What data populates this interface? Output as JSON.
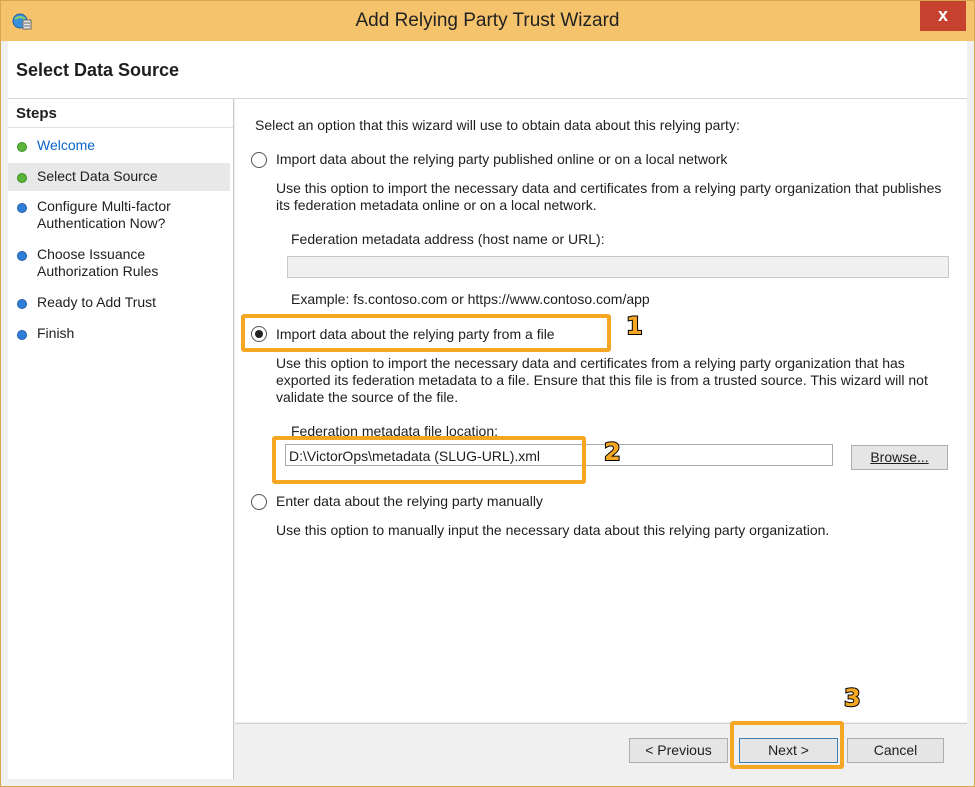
{
  "window": {
    "title": "Add Relying Party Trust Wizard",
    "close_label": "x"
  },
  "header": {
    "title": "Select Data Source"
  },
  "steps": {
    "title": "Steps",
    "items": [
      {
        "label": "Welcome",
        "state": "done-link"
      },
      {
        "label": "Select Data Source",
        "state": "current"
      },
      {
        "label": "Configure Multi-factor Authentication Now?",
        "state": "pending"
      },
      {
        "label": "Choose Issuance Authorization Rules",
        "state": "pending"
      },
      {
        "label": "Ready to Add Trust",
        "state": "pending"
      },
      {
        "label": "Finish",
        "state": "pending"
      }
    ]
  },
  "content": {
    "intro": "Select an option that this wizard will use to obtain data about this relying party:",
    "option_online": {
      "label": "Import data about the relying party published online or on a local network",
      "description": "Use this option to import the necessary data and certificates from a relying party organization that publishes its federation metadata online or on a local network.",
      "field_label": "Federation metadata address (host name or URL):",
      "field_value": "",
      "example": "Example: fs.contoso.com or https://www.contoso.com/app",
      "checked": false
    },
    "option_file": {
      "label": "Import data about the relying party from a file",
      "description": "Use this option to import the necessary data and certificates from a relying party organization that has exported its federation metadata to a file. Ensure that this file is from a trusted source.  This wizard will not validate the source of the file.",
      "field_label": "Federation metadata file location:",
      "field_value": "D:\\VictorOps\\metadata (SLUG-URL).xml",
      "browse_label": "Browse...",
      "checked": true
    },
    "option_manual": {
      "label": "Enter data about the relying party manually",
      "description": "Use this option to manually input the necessary data about this relying party organization.",
      "checked": false
    }
  },
  "footer": {
    "previous_label": "< Previous",
    "next_label": "Next >",
    "cancel_label": "Cancel"
  },
  "annotations": [
    "1",
    "2",
    "3"
  ],
  "colors": {
    "highlight": "#f5a623",
    "titlebar": "#f5c36b",
    "close": "#c7422e",
    "link": "#0a66c8"
  }
}
